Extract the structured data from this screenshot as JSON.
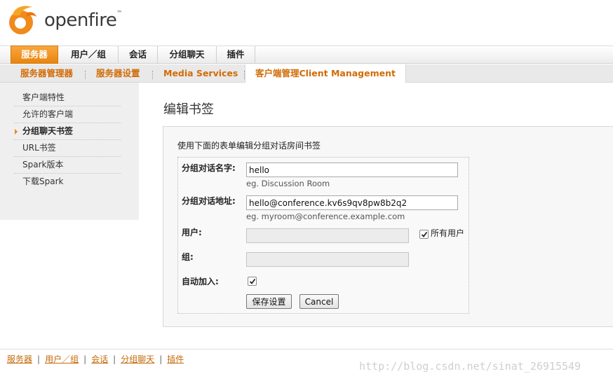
{
  "brand": {
    "name": "openfire",
    "tm": "™",
    "accent": "#e8860f"
  },
  "main_nav": [
    "服务器",
    "用户／组",
    "会话",
    "分组聊天",
    "插件"
  ],
  "sub_nav": [
    "服务器管理器",
    "服务器设置",
    "Media Services",
    "客户端管理Client Management"
  ],
  "sidebar": [
    "客户端特性",
    "允许的客户端",
    "分组聊天书签",
    "URL书签",
    "Spark版本",
    "下载Spark"
  ],
  "page": {
    "title": "编辑书签",
    "description": "使用下面的表单编辑分组对话房间书签"
  },
  "form": {
    "room_name_label": "分组对话名字:",
    "room_name_value": "hello",
    "room_name_hint": "eg. Discussion Room",
    "room_address_label": "分组对话地址:",
    "room_address_value": "hello@conference.kv6s9qv8pw8b2q2",
    "room_address_hint": "eg. myroom@conference.example.com",
    "users_label": "用户:",
    "users_value": "",
    "all_users_label": "所有用户",
    "all_users_checked": true,
    "group_label": "组:",
    "group_value": "",
    "auto_join_label": "自动加入:",
    "auto_join_checked": true,
    "save_label": "保存设置",
    "cancel_label": "Cancel"
  },
  "footer": [
    "服务器",
    "用户／组",
    "会话",
    "分组聊天",
    "插件"
  ],
  "watermark": "http://blog.csdn.net/sinat_26915549"
}
